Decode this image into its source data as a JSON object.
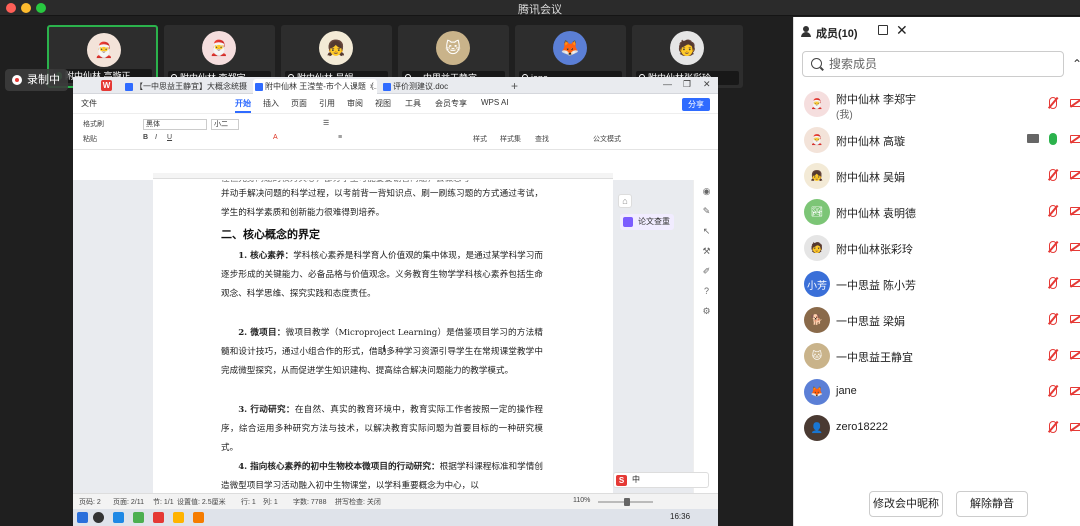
{
  "app_title": "腾讯会议",
  "recording_label": "录制中",
  "video_tiles": [
    {
      "name": "附中仙林 高璇正...",
      "avatar": "🎅",
      "color": "#f3e3d9",
      "active": true
    },
    {
      "name": "附中仙林 李郑宇",
      "avatar": "🎅",
      "color": "#f5dede"
    },
    {
      "name": "附中仙林 吴娟",
      "avatar": "👧",
      "color": "#f3ead6"
    },
    {
      "name": "一中思益王静宜",
      "avatar": "🐱",
      "color": "#c9b38a"
    },
    {
      "name": "jane",
      "avatar": "🦊",
      "color": "#5b7fd6"
    },
    {
      "name": "附中仙林张彩玲",
      "avatar": "🧑",
      "color": "#e5e5e5"
    }
  ],
  "wps": {
    "logo": "W",
    "tabs": [
      {
        "label": "【一中思益王静宜】大概念统摄下初..."
      },
      {
        "label": "附中仙林 王滢莹-市个人课题（..."
      },
      {
        "label": "评价测建议.doc"
      }
    ],
    "file_menu": "文件",
    "menus": [
      "开始",
      "插入",
      "页面",
      "引用",
      "审阅",
      "视图",
      "工具",
      "会员专享",
      "WPS AI"
    ],
    "share": "分享",
    "ribbon": {
      "format_painter": "格式刷",
      "paste": "粘贴",
      "font_name": "黑体",
      "font_size": "小二",
      "style_label": "样式",
      "style_set": "样式集",
      "find": "查找",
      "official": "公文模式"
    },
    "doc": {
      "top_line": "往但光身问题的权力关心，部分学生可能要要谢普问题，会做态考",
      "para0": "并动手解决问题的科学过程，以考前背一背知识点、刷一刷练习题的方式通过考试，学生的科学素质和创新能力很难得到培养。",
      "heading": "二、核心概念的界定",
      "items": [
        {
          "label": "1. 核心素养：",
          "text": "学科核心素养是科学育人价值观的集中体现，是通过某学科学习而逐步形成的关键能力、必备品格与价值观念。义务教育生物学学科核心素养包括生命观念、科学思维、探究实践和态度责任。"
        },
        {
          "label": "2. 微项目：",
          "text": "微项目教学（Microproject Learning）是借鉴项目学习的方法精髓和设计技巧，通过小组合作的形式，借助多种学习资源引导学生在常规课堂教学中完成微型探究，从而促进学生知识建构、提高综合解决问题能力的教学模式。"
        },
        {
          "label": "3. 行动研究：",
          "text": "在自然、真实的教育环境中，教育实际工作者按照一定的操作程序，综合运用多种研究方法与技术，以解决教育实际问题为首要目标的一种研究模式。"
        },
        {
          "label": "4. 指向核心素养的初中生物校本微项目的行动研究：",
          "text": "根据学科课程标准和学情创造微型项目学习活动融入初中生物课堂，以学科重要概念为中心，以"
        }
      ],
      "paper_check": "论文查重"
    },
    "status": {
      "page_no": "页码: 2",
      "pages": "页面: 2/11",
      "section": "节: 1/1",
      "setting": "设置值: 2.5厘米",
      "row": "行: 1",
      "col": "列: 1",
      "words": "字数: 7788",
      "spell": "拼写检查: 关闭",
      "zoom": "110%"
    },
    "ime": "中"
  },
  "taskbar": {
    "time": "16:36"
  },
  "panel": {
    "title": "成员(10)",
    "search_placeholder": "搜索成员",
    "members": [
      {
        "name": "附中仙林 李郑宇",
        "sub": "(我)",
        "avatar": "🎅",
        "color": "#f5dede",
        "mic": "muted",
        "cam": "off"
      },
      {
        "name": "附中仙林 高璇",
        "sub": "",
        "avatar": "🎅",
        "color": "#f3e3d9",
        "mic": "on",
        "cam": "off",
        "sharing": true
      },
      {
        "name": "附中仙林 吴娟",
        "sub": "",
        "avatar": "👧",
        "color": "#f3ead6",
        "mic": "muted",
        "cam": "off"
      },
      {
        "name": "附中仙林 袁明德",
        "sub": "",
        "avatar": "🏞",
        "color": "#7cc576",
        "mic": "muted",
        "cam": "off"
      },
      {
        "name": "附中仙林张彩玲",
        "sub": "",
        "avatar": "🧑",
        "color": "#e5e5e5",
        "mic": "muted",
        "cam": "off"
      },
      {
        "name": "一中思益 陈小芳",
        "sub": "",
        "avatar": "小芳",
        "color": "#3a6fd8",
        "mic": "muted",
        "cam": "off"
      },
      {
        "name": "一中思益 梁娟",
        "sub": "",
        "avatar": "🐕",
        "color": "#8a6a4a",
        "mic": "muted",
        "cam": "off"
      },
      {
        "name": "一中思益王静宜",
        "sub": "",
        "avatar": "🐱",
        "color": "#c9b38a",
        "mic": "muted",
        "cam": "off"
      },
      {
        "name": "jane",
        "sub": "",
        "avatar": "🦊",
        "color": "#5b7fd6",
        "mic": "muted",
        "cam": "off"
      },
      {
        "name": "zero18222",
        "sub": "",
        "avatar": "👤",
        "color": "#4a3a32",
        "mic": "muted",
        "cam": "off"
      }
    ],
    "rename_button": "修改会中昵称",
    "unmute_button": "解除静音"
  }
}
